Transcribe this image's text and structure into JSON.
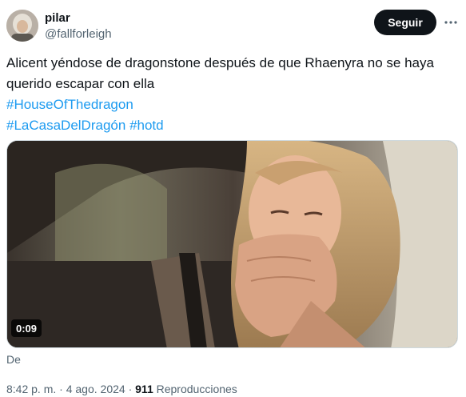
{
  "author": {
    "display_name": "pilar",
    "handle": "@fallforleigh"
  },
  "follow_button": "Seguir",
  "more_icon": "more-horizontal-icon",
  "tweet": {
    "text_line1": "Alicent yéndose de dragonstone después de que Rhaenyra no se haya",
    "text_line2": "querido escapar con ella",
    "hashtag1": "#HouseOfThedragon",
    "hashtag2": "#LaCasaDelDragón",
    "hashtag3": "#hotd"
  },
  "media": {
    "duration": "0:09",
    "from_label": "De"
  },
  "meta": {
    "time": "8:42 p. m.",
    "separator": "·",
    "date": "4 ago. 2024",
    "views_count": "911",
    "views_label": "Reproducciones"
  },
  "colors": {
    "link": "#1d9bf0",
    "secondary_text": "#536471",
    "follow_bg": "#0f1419"
  }
}
